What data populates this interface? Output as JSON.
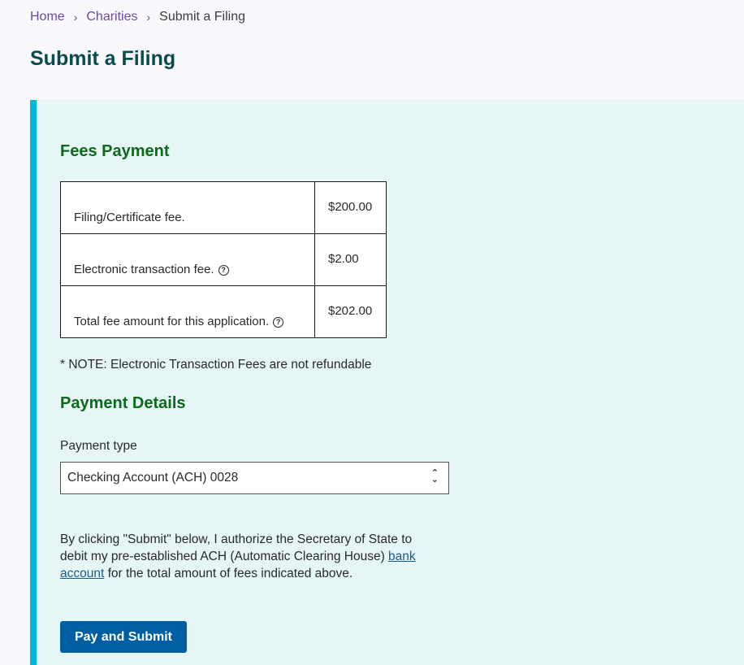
{
  "breadcrumb": {
    "items": [
      {
        "label": "Home"
      },
      {
        "label": "Charities"
      }
    ],
    "current": "Submit a Filing",
    "separator": "›"
  },
  "page": {
    "title": "Submit a Filing"
  },
  "fees": {
    "title": "Fees Payment",
    "rows": [
      {
        "label": "Filing/Certificate fee.",
        "amount": "$200.00",
        "help": false
      },
      {
        "label": "Electronic transaction fee.",
        "amount": "$2.00",
        "help": true
      },
      {
        "label": "Total fee amount for this application.",
        "amount": "$202.00",
        "help": true
      }
    ],
    "note": "* NOTE: Electronic Transaction Fees are not refundable"
  },
  "payment": {
    "title": "Payment Details",
    "type_label": "Payment type",
    "type_value": "Checking Account (ACH) 0028",
    "auth_text_before": "By clicking \"Submit\" below, I authorize the Secretary of State to debit my pre-established ACH (Automatic Clearing House) ",
    "auth_link": "bank account",
    "auth_text_after": " for the total amount of fees indicated above.",
    "submit_label": "Pay and Submit"
  },
  "icons": {
    "help": "?",
    "chevron": "⌃⌄"
  },
  "colors": {
    "accent_bar": "#00b8d9",
    "section_heading": "#0d6a1a",
    "page_title": "#0b4a4f",
    "button": "#005ea2",
    "panel_bg": "#e6f5f6"
  }
}
